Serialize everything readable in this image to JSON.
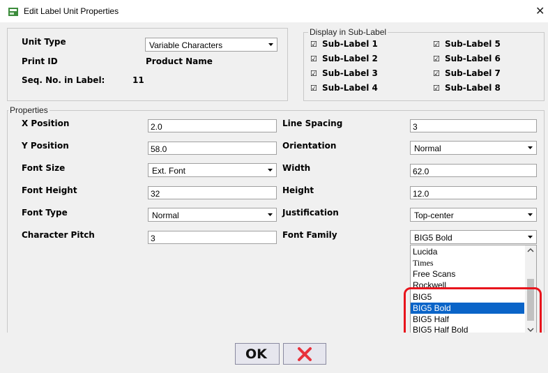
{
  "window": {
    "title": "Edit Label Unit Properties",
    "close_glyph": "✕"
  },
  "unit_info": {
    "unit_type_label": "Unit Type",
    "unit_type_value": "Variable Characters",
    "print_id_label": "Print ID",
    "print_id_value": "Product Name",
    "seq_label": "Seq. No. in Label:",
    "seq_value": "11"
  },
  "sub_label_group": {
    "legend": "Display in Sub-Label",
    "items": [
      {
        "label": "Sub-Label 1",
        "checked": true
      },
      {
        "label": "Sub-Label 2",
        "checked": true
      },
      {
        "label": "Sub-Label 3",
        "checked": true
      },
      {
        "label": "Sub-Label 4",
        "checked": true
      },
      {
        "label": "Sub-Label 5",
        "checked": true
      },
      {
        "label": "Sub-Label 6",
        "checked": true
      },
      {
        "label": "Sub-Label 7",
        "checked": true
      },
      {
        "label": "Sub-Label 8",
        "checked": true
      }
    ],
    "check_glyph": "☑"
  },
  "properties": {
    "legend": "Properties",
    "left": {
      "x_position_label": "X Position",
      "x_position_value": "2.0",
      "y_position_label": "Y Position",
      "y_position_value": "58.0",
      "font_size_label": "Font Size",
      "font_size_value": "Ext. Font",
      "font_height_label": "Font Height",
      "font_height_value": "32",
      "font_type_label": "Font Type",
      "font_type_value": "Normal",
      "char_pitch_label": "Character Pitch",
      "char_pitch_value": "3"
    },
    "right": {
      "line_spacing_label": "Line Spacing",
      "line_spacing_value": "3",
      "orientation_label": "Orientation",
      "orientation_value": "Normal",
      "width_label": "Width",
      "width_value": "62.0",
      "height_label": "Height",
      "height_value": "12.0",
      "justification_label": "Justification",
      "justification_value": "Top-center",
      "font_family_label": "Font Family",
      "font_family_value": "BIG5 Bold"
    }
  },
  "font_family_list": {
    "items": [
      "Lucida",
      "Times",
      "Free Scans",
      "Rockwell",
      "BIG5",
      "BIG5 Bold",
      "BIG5 Half",
      "BIG5 Half Bold"
    ],
    "selected": "BIG5 Bold"
  },
  "buttons": {
    "ok_label": "OK",
    "cancel_glyph": "✕"
  },
  "colors": {
    "highlight": "#e8141c",
    "selection": "#0a64c8",
    "cancel_x": "#e8323c"
  }
}
